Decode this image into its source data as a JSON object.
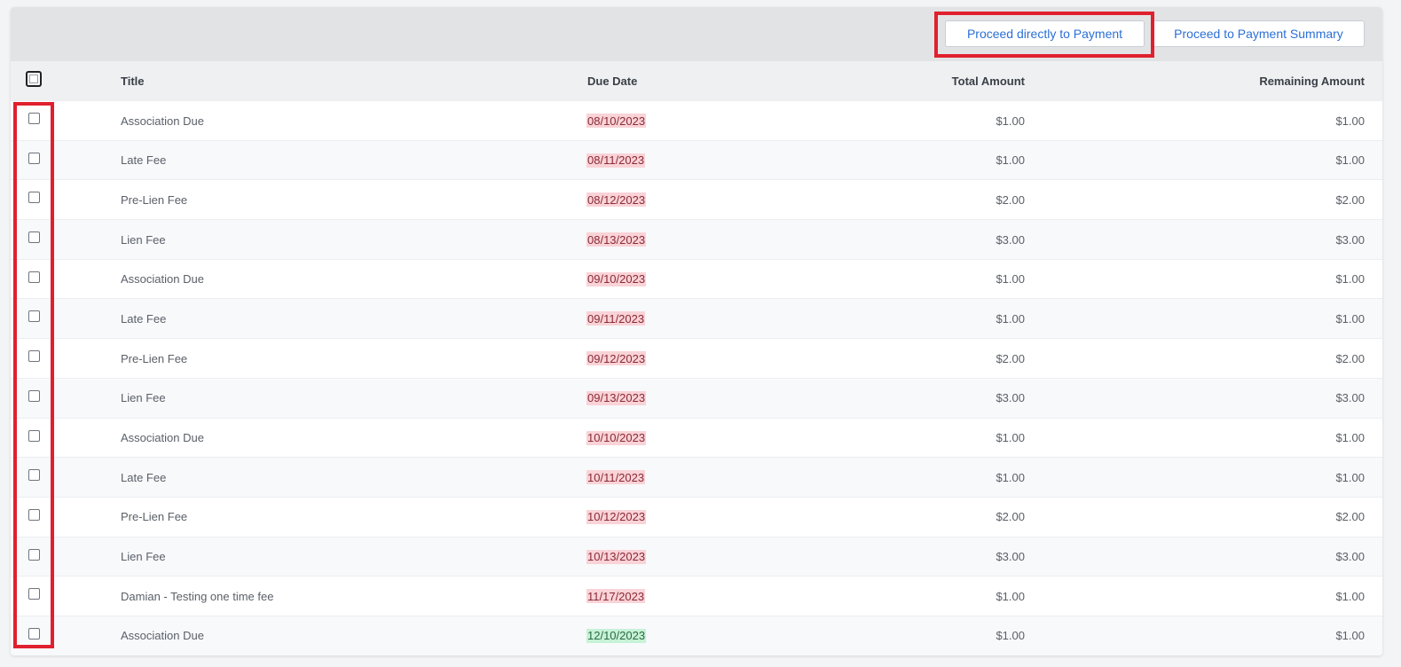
{
  "toolbar": {
    "proceed_direct_label": "Proceed directly to Payment",
    "proceed_summary_label": "Proceed to Payment Summary"
  },
  "table": {
    "columns": {
      "title": "Title",
      "due_date": "Due Date",
      "total_amount": "Total Amount",
      "remaining_amount": "Remaining Amount"
    },
    "rows": [
      {
        "title": "Association Due",
        "due": "08/10/2023",
        "status": "overdue",
        "total": "$1.00",
        "remaining": "$1.00"
      },
      {
        "title": "Late Fee",
        "due": "08/11/2023",
        "status": "overdue",
        "total": "$1.00",
        "remaining": "$1.00"
      },
      {
        "title": "Pre-Lien Fee",
        "due": "08/12/2023",
        "status": "overdue",
        "total": "$2.00",
        "remaining": "$2.00"
      },
      {
        "title": "Lien Fee",
        "due": "08/13/2023",
        "status": "overdue",
        "total": "$3.00",
        "remaining": "$3.00"
      },
      {
        "title": "Association Due",
        "due": "09/10/2023",
        "status": "overdue",
        "total": "$1.00",
        "remaining": "$1.00"
      },
      {
        "title": "Late Fee",
        "due": "09/11/2023",
        "status": "overdue",
        "total": "$1.00",
        "remaining": "$1.00"
      },
      {
        "title": "Pre-Lien Fee",
        "due": "09/12/2023",
        "status": "overdue",
        "total": "$2.00",
        "remaining": "$2.00"
      },
      {
        "title": "Lien Fee",
        "due": "09/13/2023",
        "status": "overdue",
        "total": "$3.00",
        "remaining": "$3.00"
      },
      {
        "title": "Association Due",
        "due": "10/10/2023",
        "status": "overdue",
        "total": "$1.00",
        "remaining": "$1.00"
      },
      {
        "title": "Late Fee",
        "due": "10/11/2023",
        "status": "overdue",
        "total": "$1.00",
        "remaining": "$1.00"
      },
      {
        "title": "Pre-Lien Fee",
        "due": "10/12/2023",
        "status": "overdue",
        "total": "$2.00",
        "remaining": "$2.00"
      },
      {
        "title": "Lien Fee",
        "due": "10/13/2023",
        "status": "overdue",
        "total": "$3.00",
        "remaining": "$3.00"
      },
      {
        "title": "Damian - Testing one time fee",
        "due": "11/17/2023",
        "status": "overdue",
        "total": "$1.00",
        "remaining": "$1.00"
      },
      {
        "title": "Association Due",
        "due": "12/10/2023",
        "status": "upcoming",
        "total": "$1.00",
        "remaining": "$1.00"
      }
    ]
  },
  "colors": {
    "accent": "#2b6fd6",
    "highlight": "#e0202e",
    "overdue_bg": "#f9d3d7",
    "upcoming_bg": "#c7f2d6"
  }
}
